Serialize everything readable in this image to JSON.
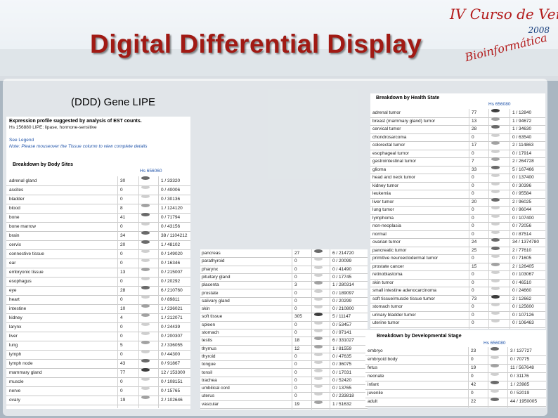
{
  "title": "Digital Differential Display",
  "subtitle": "(DDD) Gene LIPE",
  "logo": {
    "line1": "IV Curso de Verão",
    "year": "2008",
    "line3": "Bioinformática"
  },
  "body_sites_panel": {
    "header": "Expression profile suggested by analysis of EST counts.",
    "gene": "Hs 156880  LIPE: lipase, hormone-sensitive",
    "legend_link": "See Legend",
    "note": "Note: Please mouseover the Tissue column to view complete details",
    "section_title": "Breakdown by Body Sites",
    "hs_id": "Hs 656060",
    "rows": [
      {
        "name": "adrenal gland",
        "n": "30",
        "v": "1 / 33320"
      },
      {
        "name": "ascites",
        "n": "0",
        "v": "0 / 40006"
      },
      {
        "name": "bladder",
        "n": "0",
        "v": "0 / 30136"
      },
      {
        "name": "blood",
        "n": "8",
        "v": "1 / 124120"
      },
      {
        "name": "bone",
        "n": "41",
        "v": "0 / 71794"
      },
      {
        "name": "bone marrow",
        "n": "0",
        "v": "0 / 43156"
      },
      {
        "name": "brain",
        "n": "34",
        "v": "38 / 1104212"
      },
      {
        "name": "cervix",
        "n": "20",
        "v": "1 / 48102"
      },
      {
        "name": "connective tissue",
        "n": "0",
        "v": "0 / 149020"
      },
      {
        "name": "ear",
        "n": "0",
        "v": "0 / 16346"
      },
      {
        "name": "embryonic tissue",
        "n": "13",
        "v": "0 / 215007"
      },
      {
        "name": "esophagus",
        "n": "0",
        "v": "0 / 20292"
      },
      {
        "name": "eye",
        "n": "28",
        "v": "6 / 210760"
      },
      {
        "name": "heart",
        "n": "0",
        "v": "0 / 89811"
      },
      {
        "name": "intestine",
        "n": "10",
        "v": "1 / 236021"
      },
      {
        "name": "kidney",
        "n": "4",
        "v": "1 / 212071"
      },
      {
        "name": "larynx",
        "n": "0",
        "v": "0 / 24439"
      },
      {
        "name": "liver",
        "n": "0",
        "v": "0 / 200307"
      },
      {
        "name": "lung",
        "n": "5",
        "v": "2 / 336055"
      },
      {
        "name": "lymph",
        "n": "0",
        "v": "0 / 44300"
      },
      {
        "name": "lymph node",
        "n": "43",
        "v": "0 / 91867"
      },
      {
        "name": "mammary gland",
        "n": "77",
        "v": "12 / 153300"
      },
      {
        "name": "muscle",
        "n": "0",
        "v": "0 / 108151"
      },
      {
        "name": "nerve",
        "n": "0",
        "v": "0 / 15765"
      },
      {
        "name": "ovary",
        "n": "19",
        "v": "2 / 102646"
      }
    ]
  },
  "body_sites_cont_panel": {
    "rows": [
      {
        "name": "pancreas",
        "n": "27",
        "v": "6 / 214720"
      },
      {
        "name": "parathyroid",
        "n": "0",
        "v": "0 / 20099"
      },
      {
        "name": "pharynx",
        "n": "0",
        "v": "0 / 41490"
      },
      {
        "name": "pituitary gland",
        "n": "0",
        "v": "0 / 17745"
      },
      {
        "name": "placenta",
        "n": "3",
        "v": "1 / 280314"
      },
      {
        "name": "prostate",
        "n": "0",
        "v": "0 / 189097"
      },
      {
        "name": "salivary gland",
        "n": "0",
        "v": "0 / 20299"
      },
      {
        "name": "skin",
        "n": "0",
        "v": "0 / 210800"
      },
      {
        "name": "soft tissue",
        "n": "305",
        "v": "5 / 11147"
      },
      {
        "name": "spleen",
        "n": "0",
        "v": "0 / 53457"
      },
      {
        "name": "stomach",
        "n": "0",
        "v": "0 / 97141"
      },
      {
        "name": "testis",
        "n": "18",
        "v": "6 / 331027"
      },
      {
        "name": "thymus",
        "n": "12",
        "v": "1 / 81559"
      },
      {
        "name": "thyroid",
        "n": "0",
        "v": "0 / 47635"
      },
      {
        "name": "tongue",
        "n": "0",
        "v": "0 / 36075"
      },
      {
        "name": "tonsil",
        "n": "0",
        "v": "0 / 17031"
      },
      {
        "name": "trachea",
        "n": "0",
        "v": "0 / 52420"
      },
      {
        "name": "umbilical cord",
        "n": "0",
        "v": "0 / 13765"
      },
      {
        "name": "uterus",
        "n": "0",
        "v": "0 / 233818"
      },
      {
        "name": "vascular",
        "n": "19",
        "v": "1 / 51632"
      }
    ]
  },
  "health_state_panel": {
    "section_title": "Breakdown by Health State",
    "hs_id": "Hs 656080",
    "rows": [
      {
        "name": "adrenal tumor",
        "n": "77",
        "v": "1 / 12840"
      },
      {
        "name": "breast (mammary gland) tumor",
        "n": "13",
        "v": "1 / 94672"
      },
      {
        "name": "cervical tumor",
        "n": "28",
        "v": "1 / 34630"
      },
      {
        "name": "chondrosarcoma",
        "n": "0",
        "v": "0 / 63540"
      },
      {
        "name": "colorectal tumor",
        "n": "17",
        "v": "2 / 114863"
      },
      {
        "name": "esophageal tumor",
        "n": "0",
        "v": "0 / 17914"
      },
      {
        "name": "gastrointestinal tumor",
        "n": "7",
        "v": "2 / 264728"
      },
      {
        "name": "glioma",
        "n": "33",
        "v": "5 / 167466"
      },
      {
        "name": "head and neck tumor",
        "n": "0",
        "v": "0 / 137400"
      },
      {
        "name": "kidney tumor",
        "n": "0",
        "v": "0 / 30396"
      },
      {
        "name": "leukemia",
        "n": "0",
        "v": "0 / 95584"
      },
      {
        "name": "liver tumor",
        "n": "20",
        "v": "2 / 96025"
      },
      {
        "name": "lung tumor",
        "n": "0",
        "v": "0 / 96044"
      },
      {
        "name": "lymphoma",
        "n": "0",
        "v": "0 / 107400"
      },
      {
        "name": "non-neoplasia",
        "n": "0",
        "v": "0 / 72056"
      },
      {
        "name": "normal",
        "n": "0",
        "v": "0 / 87514"
      },
      {
        "name": "ovarian tumor",
        "n": "24",
        "v": "34 / 1374780"
      },
      {
        "name": "pancreatic tumor",
        "n": "25",
        "v": "2 / 77610"
      },
      {
        "name": "primitive neuroectodermal tumor",
        "n": "0",
        "v": "0 / 71605"
      },
      {
        "name": "prostate cancer",
        "n": "15",
        "v": "2 / 126405"
      },
      {
        "name": "retinoblastoma",
        "n": "0",
        "v": "0 / 103067"
      },
      {
        "name": "skin tumor",
        "n": "0",
        "v": "0 / 46510"
      },
      {
        "name": "small intestine adenocarcinoma",
        "n": "0",
        "v": "0 / 24660"
      },
      {
        "name": "soft tissue/muscle tissue tumor",
        "n": "73",
        "v": "2 / 12662"
      },
      {
        "name": "stomach tumor",
        "n": "0",
        "v": "0 / 125600"
      },
      {
        "name": "urinary bladder tumor",
        "n": "0",
        "v": "0 / 107126"
      },
      {
        "name": "uterine tumor",
        "n": "0",
        "v": "0 / 106463"
      }
    ]
  },
  "dev_stage_panel": {
    "section_title": "Breakdown by Developmental Stage",
    "hs_id": "Hs 656080",
    "rows": [
      {
        "name": "embryo",
        "n": "23",
        "v": "3 / 137727"
      },
      {
        "name": "embryoid body",
        "n": "0",
        "v": "0 / 70775"
      },
      {
        "name": "fetus",
        "n": "19",
        "v": "11 / 567648"
      },
      {
        "name": "neonate",
        "n": "0",
        "v": "0 / 31176"
      },
      {
        "name": "infant",
        "n": "42",
        "v": "1 / 23985"
      },
      {
        "name": "juvenile",
        "n": "0",
        "v": "0 / 52019"
      },
      {
        "name": "adult",
        "n": "22",
        "v": "44 / 1950005"
      }
    ]
  }
}
